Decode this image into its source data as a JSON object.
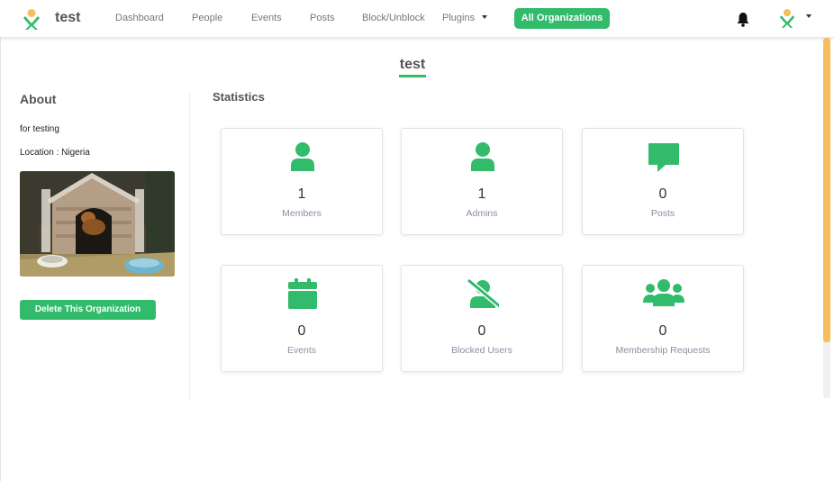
{
  "navbar": {
    "brand": "test",
    "links": [
      {
        "label": "Dashboard"
      },
      {
        "label": "People"
      },
      {
        "label": "Events"
      },
      {
        "label": "Posts"
      },
      {
        "label": "Block/Unblock"
      },
      {
        "label": "Plugins"
      }
    ],
    "active_label": "All Organizations",
    "icons": [
      "logo-icon",
      "bell-icon",
      "user-avatar-icon",
      "caret-down-icon"
    ]
  },
  "header": {
    "title": "test"
  },
  "about": {
    "title": "About",
    "description": "for testing",
    "location": "Location : Nigeria",
    "delete_label": "Delete This Organization"
  },
  "statistics": {
    "title": "Statistics",
    "cards": [
      {
        "value": "1",
        "label": "Members",
        "icon": "user-icon"
      },
      {
        "value": "1",
        "label": "Admins",
        "icon": "user-icon"
      },
      {
        "value": "0",
        "label": "Posts",
        "icon": "comment-icon"
      },
      {
        "value": "0",
        "label": "Events",
        "icon": "calendar-icon"
      },
      {
        "value": "0",
        "label": "Blocked Users",
        "icon": "user-slash-icon"
      },
      {
        "value": "0",
        "label": "Membership Requests",
        "icon": "users-icon"
      }
    ]
  },
  "colors": {
    "accent": "#31bb6b",
    "scroll_thumb": "#f7be5c"
  }
}
